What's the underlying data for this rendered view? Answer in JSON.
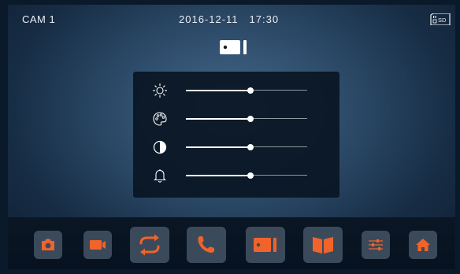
{
  "header": {
    "camera_label": "CAM 1",
    "date": "2016-12-11",
    "time": "17:30",
    "storage_badge": "SD"
  },
  "mode_icon": "camera-monitor-icon",
  "adjust_panel": {
    "sliders": [
      {
        "name": "brightness",
        "icon": "brightness-icon",
        "level": 0.53
      },
      {
        "name": "color",
        "icon": "color-palette-icon",
        "level": 0.53
      },
      {
        "name": "contrast",
        "icon": "contrast-icon",
        "level": 0.53
      },
      {
        "name": "volume",
        "icon": "bell-icon",
        "level": 0.53
      }
    ]
  },
  "toolbar": {
    "buttons": [
      {
        "icon": "camera-icon"
      },
      {
        "icon": "video-icon"
      },
      {
        "icon": "switch-icon"
      },
      {
        "icon": "phone-icon"
      },
      {
        "icon": "monitor-icon"
      },
      {
        "icon": "book-icon"
      },
      {
        "icon": "settings-icon"
      },
      {
        "icon": "home-icon"
      }
    ]
  },
  "colors": {
    "accent": "#f0632b",
    "button_bg": "#3b4a5b",
    "text": "#e9eef5"
  }
}
